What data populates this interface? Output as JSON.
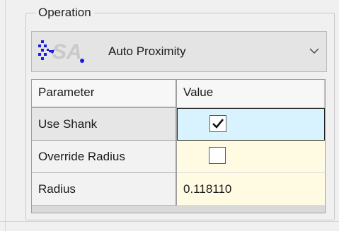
{
  "operation": {
    "group_title": "Operation",
    "selected_label": "Auto Proximity",
    "icon": "sa-auto-proximity-icon",
    "dropdown_icon": "chevron-down-icon"
  },
  "grid": {
    "header": {
      "parameter": "Parameter",
      "value": "Value"
    },
    "rows": [
      {
        "parameter": "Use Shank",
        "type": "checkbox",
        "checked": true,
        "selected": true
      },
      {
        "parameter": "Override Radius",
        "type": "checkbox",
        "checked": false,
        "selected": false
      },
      {
        "parameter": "Radius",
        "type": "text",
        "value": "0.118110",
        "selected": false
      }
    ]
  },
  "colors": {
    "selected_value_bg": "#d8f3fd",
    "value_bg": "#fffbe3",
    "sa_logo_blue": "#1c1ce0",
    "sa_logo_gray": "#c8c8c8"
  }
}
